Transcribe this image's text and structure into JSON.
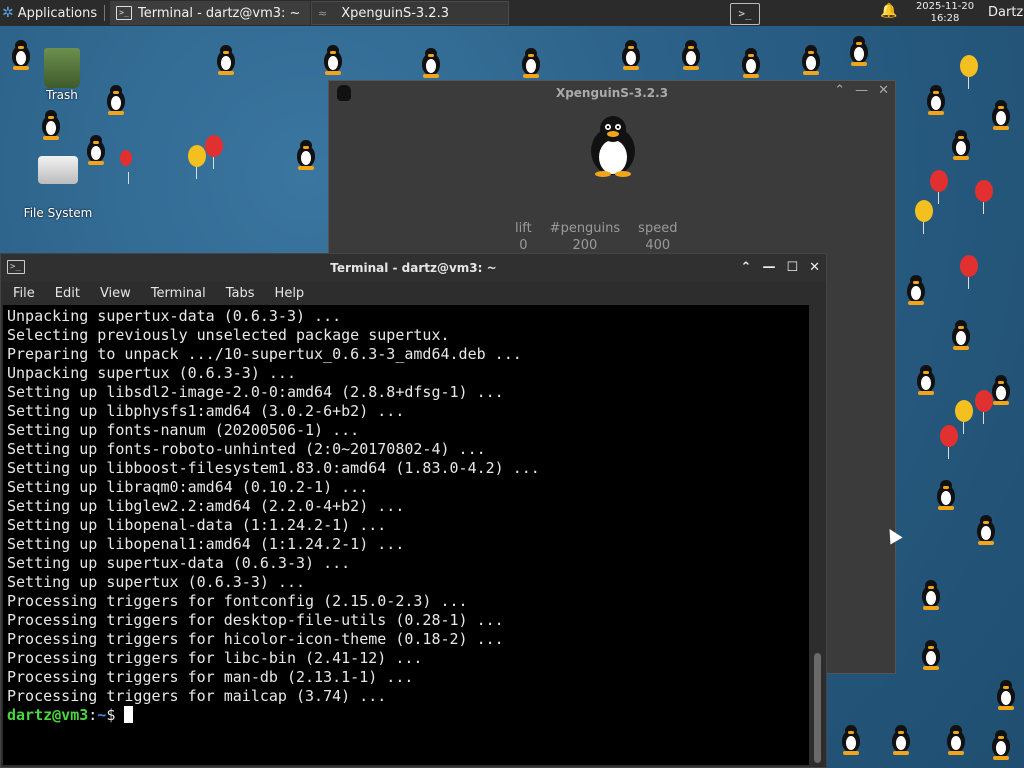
{
  "panel": {
    "applications_label": "Applications",
    "tasks": [
      {
        "label": "Terminal - dartz@vm3: ~",
        "active": true
      },
      {
        "label": "XpenguinS-3.2.3",
        "active": false
      }
    ],
    "clock_date": "2025-11-20",
    "clock_time": "16:28",
    "user": "Dartz"
  },
  "desktop": {
    "icons": [
      {
        "label": "Trash",
        "icon": "trash-icon"
      },
      {
        "label": "File System",
        "icon": "drive-icon"
      }
    ]
  },
  "xpenguins": {
    "title": "XpenguinS-3.2.3",
    "stats": [
      {
        "label": "lift",
        "value": "0"
      },
      {
        "label": "#penguins",
        "value": "200"
      },
      {
        "label": "speed",
        "value": "400"
      }
    ]
  },
  "terminal": {
    "title": "Terminal - dartz@vm3: ~",
    "menu": [
      "File",
      "Edit",
      "View",
      "Terminal",
      "Tabs",
      "Help"
    ],
    "lines": [
      "Unpacking supertux-data (0.6.3-3) ...",
      "Selecting previously unselected package supertux.",
      "Preparing to unpack .../10-supertux_0.6.3-3_amd64.deb ...",
      "Unpacking supertux (0.6.3-3) ...",
      "Setting up libsdl2-image-2.0-0:amd64 (2.8.8+dfsg-1) ...",
      "Setting up libphysfs1:amd64 (3.0.2-6+b2) ...",
      "Setting up fonts-nanum (20200506-1) ...",
      "Setting up fonts-roboto-unhinted (2:0~20170802-4) ...",
      "Setting up libboost-filesystem1.83.0:amd64 (1.83.0-4.2) ...",
      "Setting up libraqm0:amd64 (0.10.2-1) ...",
      "Setting up libglew2.2:amd64 (2.2.0-4+b2) ...",
      "Setting up libopenal-data (1:1.24.2-1) ...",
      "Setting up libopenal1:amd64 (1:1.24.2-1) ...",
      "Setting up supertux-data (0.6.3-3) ...",
      "Setting up supertux (0.6.3-3) ...",
      "Processing triggers for fontconfig (2.15.0-2.3) ...",
      "Processing triggers for desktop-file-utils (0.28-1) ...",
      "Processing triggers for hicolor-icon-theme (0.18-2) ...",
      "Processing triggers for libc-bin (2.41-12) ...",
      "Processing triggers for man-db (2.13.1-1) ...",
      "Processing triggers for mailcap (3.74) ..."
    ],
    "prompt_user": "dartz@vm3",
    "prompt_sep": ":",
    "prompt_path": "~",
    "prompt_symbol": "$"
  },
  "colors": {
    "prompt_user": "#4bd63f",
    "prompt_path": "#3b8eea",
    "terminal_bg": "#000000",
    "desktop_bg": "#2a5f86"
  }
}
